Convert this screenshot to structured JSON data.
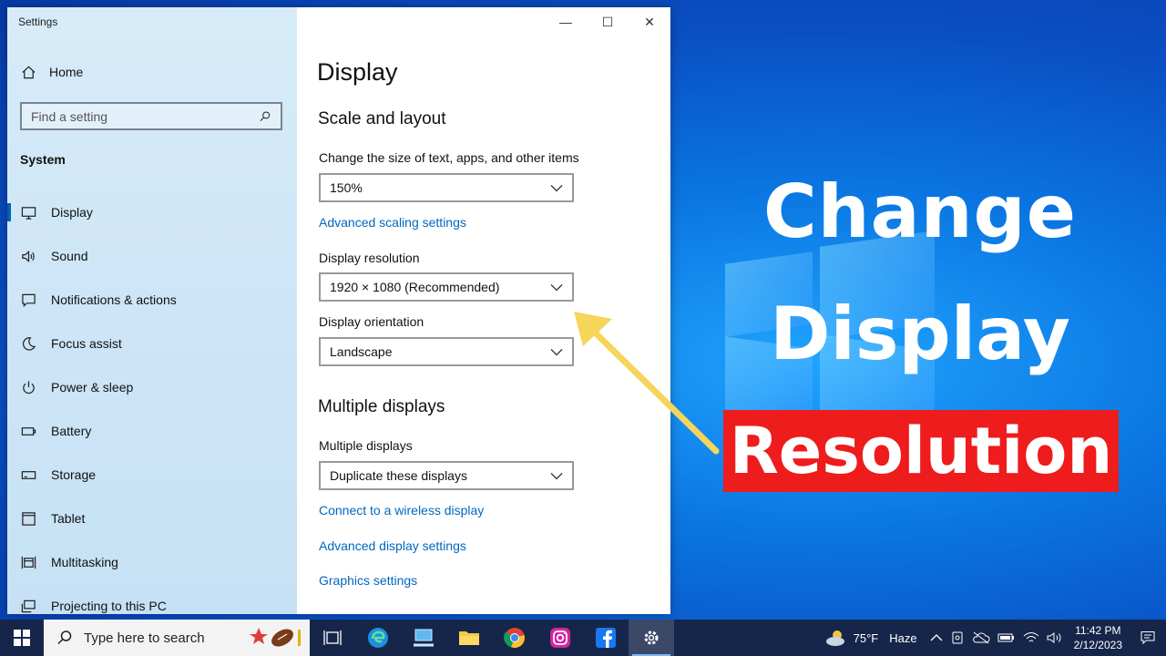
{
  "window": {
    "title": "Settings",
    "controls": {
      "minimize": "—",
      "maximize": "☐",
      "close": "✕"
    }
  },
  "sidebar": {
    "home_label": "Home",
    "search_placeholder": "Find a setting",
    "section_heading": "System",
    "items": [
      {
        "label": "Display",
        "icon": "monitor-icon",
        "active": true
      },
      {
        "label": "Sound",
        "icon": "speaker-icon"
      },
      {
        "label": "Notifications & actions",
        "icon": "notification-icon"
      },
      {
        "label": "Focus assist",
        "icon": "moon-icon"
      },
      {
        "label": "Power & sleep",
        "icon": "power-icon"
      },
      {
        "label": "Battery",
        "icon": "battery-icon"
      },
      {
        "label": "Storage",
        "icon": "storage-icon"
      },
      {
        "label": "Tablet",
        "icon": "tablet-icon"
      },
      {
        "label": "Multitasking",
        "icon": "multitasking-icon"
      },
      {
        "label": "Projecting to this PC",
        "icon": "projecting-icon"
      }
    ]
  },
  "main": {
    "title": "Display",
    "scale_section": "Scale and layout",
    "scale_label": "Change the size of text, apps, and other items",
    "scale_value": "150%",
    "advanced_scaling_link": "Advanced scaling settings",
    "resolution_label": "Display resolution",
    "resolution_value": "1920 × 1080 (Recommended)",
    "orientation_label": "Display orientation",
    "orientation_value": "Landscape",
    "multiple_section": "Multiple displays",
    "multiple_label": "Multiple displays",
    "multiple_value": "Duplicate these displays",
    "wireless_link": "Connect to a wireless display",
    "advanced_display_link": "Advanced display settings",
    "graphics_link": "Graphics settings"
  },
  "overlay": {
    "line1": "Change",
    "line2": "Display",
    "line3": "Resolution",
    "highlight_color": "#ee1c1c",
    "arrow_color": "#f5d55a"
  },
  "taskbar": {
    "search_placeholder": "Type here to search",
    "apps": [
      "task-view-icon",
      "edge-icon",
      "network-pc-icon",
      "file-explorer-icon",
      "chrome-icon",
      "instagram-icon",
      "facebook-icon",
      "settings-icon"
    ],
    "weather_temp": "75°F",
    "weather_desc": "Haze",
    "time": "11:42 PM",
    "date": "2/12/2023"
  }
}
